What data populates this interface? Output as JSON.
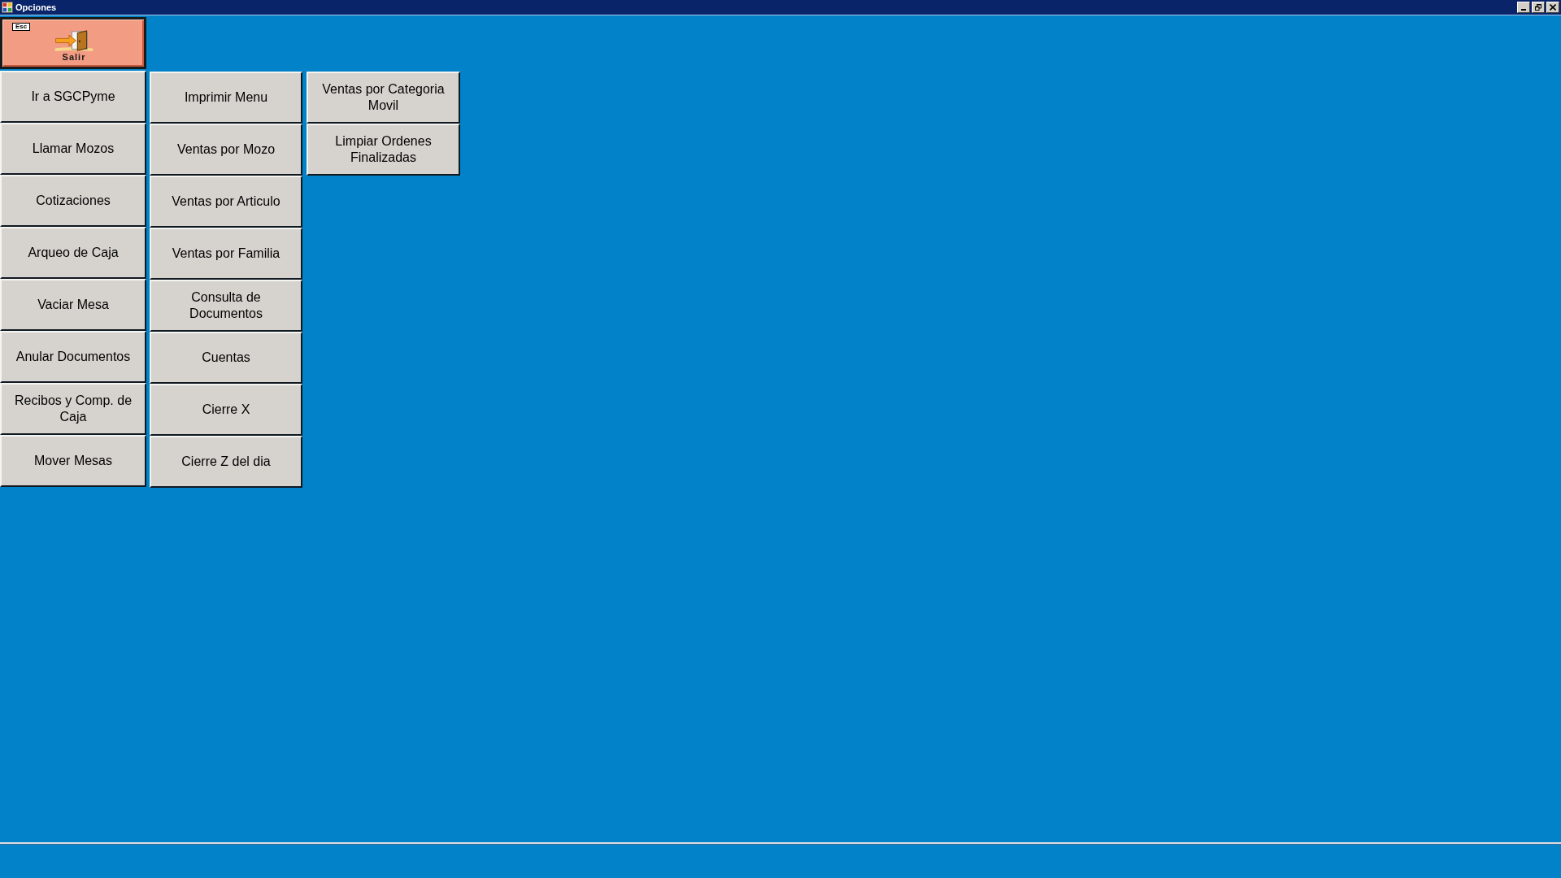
{
  "window": {
    "title": "Opciones"
  },
  "exit_button": {
    "shortcut": "Esc",
    "label": "Salir"
  },
  "menu_columns": [
    {
      "buttons": [
        "Ir a SGCPyme",
        "Llamar Mozos",
        "Cotizaciones",
        "Arqueo de Caja",
        "Vaciar Mesa",
        "Anular Documentos",
        "Recibos y Comp. de Caja",
        "Mover Mesas"
      ]
    },
    {
      "buttons": [
        "Imprimir Menu",
        "Ventas por Mozo",
        "Ventas por Articulo",
        "Ventas por Familia",
        "Consulta de Documentos",
        "Cuentas",
        "Cierre X",
        "Cierre Z del dia"
      ]
    },
    {
      "buttons": [
        "Ventas por Categoria Movil",
        "Limpiar Ordenes Finalizadas"
      ]
    }
  ]
}
